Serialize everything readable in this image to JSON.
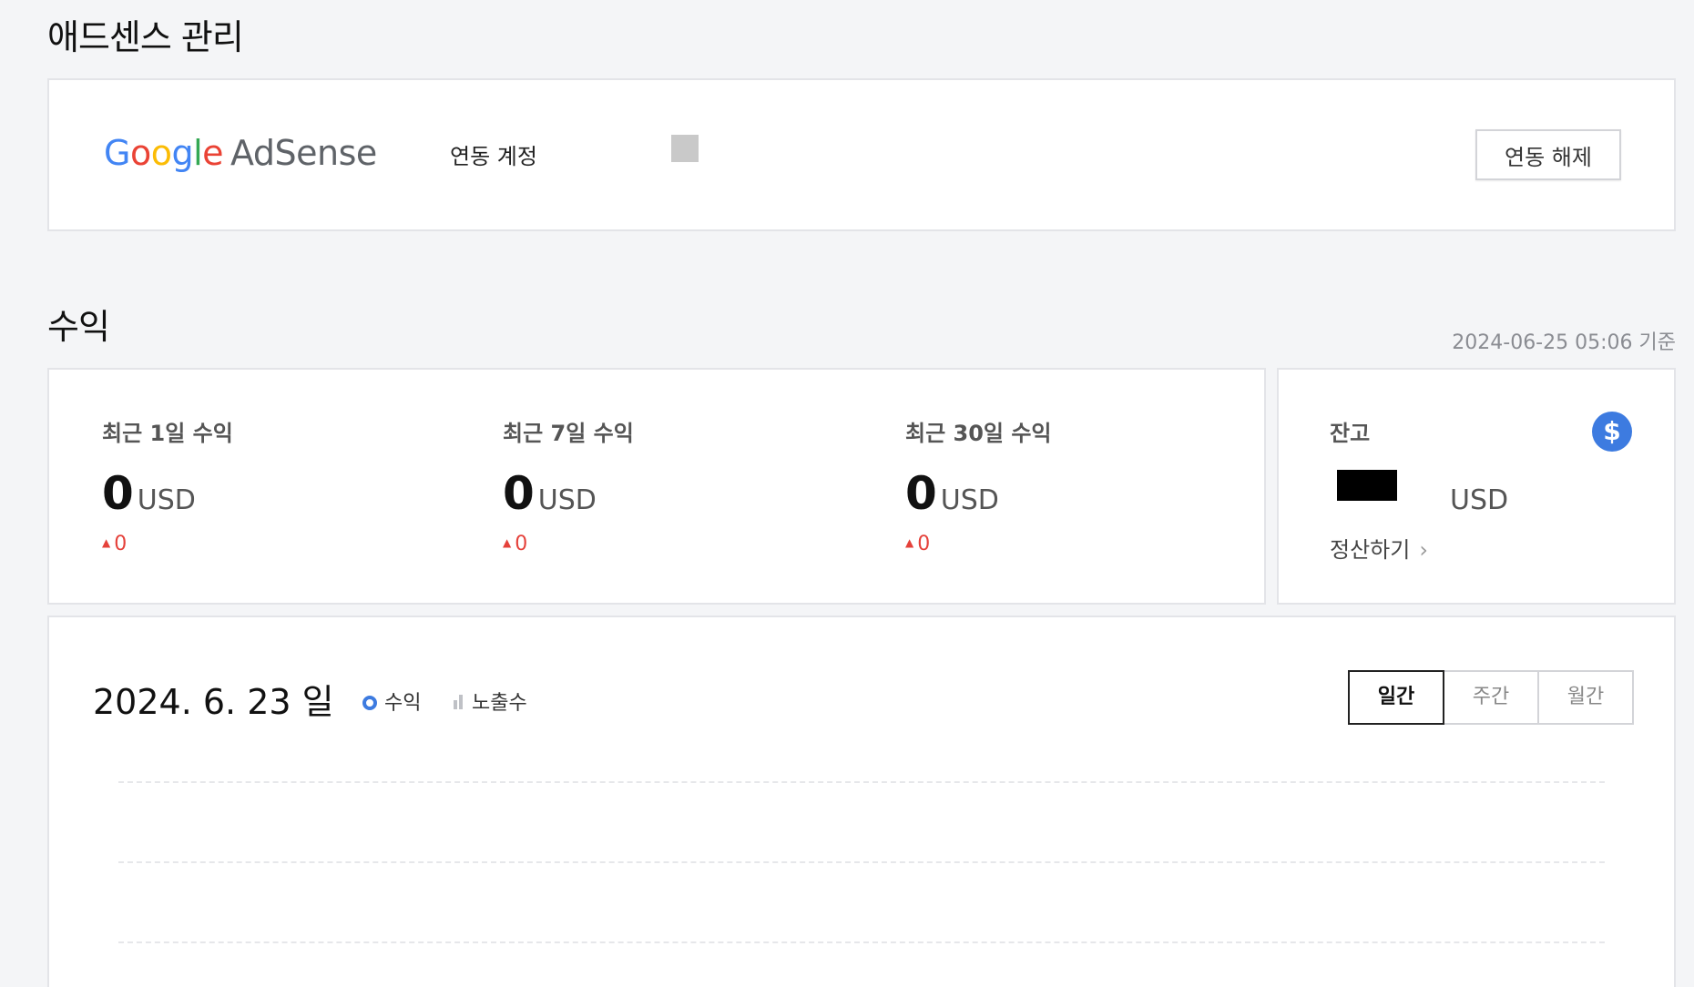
{
  "adsense_section": {
    "title": "애드센스 관리",
    "logo": {
      "g1": "G",
      "o1": "o",
      "o2": "o",
      "g2": "g",
      "l": "l",
      "e": "e",
      "product": "AdSense"
    },
    "account_label": "연동 계정",
    "unlink_button": "연동 해제"
  },
  "revenue_section": {
    "title": "수익",
    "timestamp": "2024-06-25 05:06 기준",
    "stats": [
      {
        "label": "최근 1일 수익",
        "value": "0",
        "unit": "USD",
        "delta": "0"
      },
      {
        "label": "최근 7일 수익",
        "value": "0",
        "unit": "USD",
        "delta": "0"
      },
      {
        "label": "최근 30일 수익",
        "value": "0",
        "unit": "USD",
        "delta": "0"
      }
    ],
    "balance": {
      "label": "잔고",
      "unit": "USD",
      "settle_link": "정산하기",
      "icon": "dollar-icon"
    }
  },
  "chart": {
    "date": "2024. 6. 23 일",
    "legend": [
      {
        "label": "수익",
        "icon": "ring-icon",
        "color": "#3d7be0"
      },
      {
        "label": "노출수",
        "icon": "bars-icon",
        "color": "#bfc1c6"
      }
    ],
    "periods": [
      "일간",
      "주간",
      "월간"
    ],
    "active_period": "일간"
  },
  "colors": {
    "accent_blue": "#3d7be0",
    "delta_red": "#e5413a",
    "background": "#f4f5f7"
  }
}
